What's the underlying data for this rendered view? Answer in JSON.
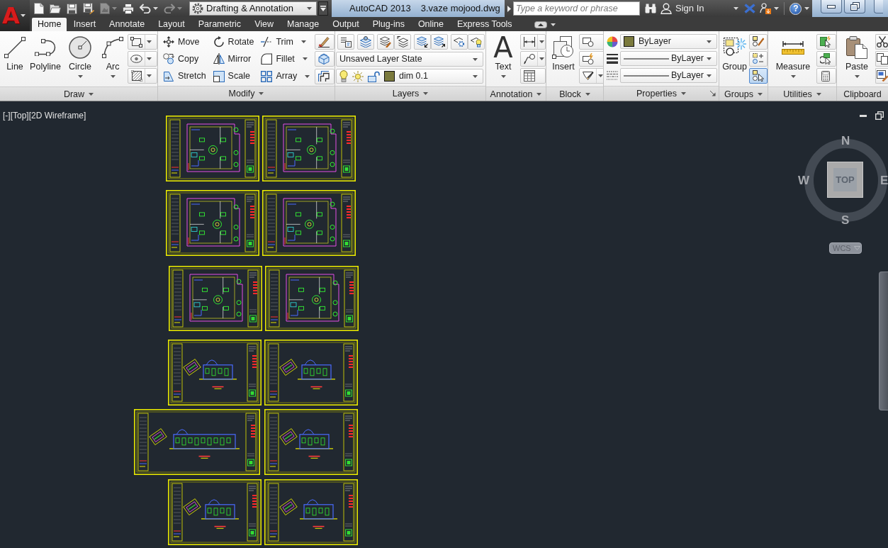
{
  "app_button": {
    "logo": "A"
  },
  "quick_access": {
    "tools": [
      {
        "disabled": false,
        "dropdown": false
      },
      {
        "disabled": false,
        "dropdown": false
      },
      {
        "disabled": false,
        "dropdown": false
      },
      {
        "disabled": false,
        "dropdown": false
      },
      {
        "disabled": true,
        "dropdown": true
      },
      {
        "disabled": false,
        "dropdown": false
      },
      {
        "disabled": false,
        "dropdown": true
      },
      {
        "disabled": true,
        "dropdown": true
      }
    ],
    "workspace": "Drafting & Annotation"
  },
  "title_bar": {
    "app_title": "AutoCAD 2013",
    "file_name": "3.vaze mojood.dwg",
    "search": {
      "placeholder": "Type a keyword or phrase"
    },
    "sign_in": "Sign In",
    "help": "?"
  },
  "ribbon_tabs": [
    {
      "label": "Home",
      "selected": true
    },
    {
      "label": "Insert",
      "selected": false
    },
    {
      "label": "Annotate",
      "selected": false
    },
    {
      "label": "Layout",
      "selected": false
    },
    {
      "label": "Parametric",
      "selected": false
    },
    {
      "label": "View",
      "selected": false
    },
    {
      "label": "Manage",
      "selected": false
    },
    {
      "label": "Output",
      "selected": false
    },
    {
      "label": "Plug-ins",
      "selected": false
    },
    {
      "label": "Online",
      "selected": false
    },
    {
      "label": "Express Tools",
      "selected": false
    }
  ],
  "draw_panel": {
    "title": "Draw",
    "expandable": true,
    "large_tools": [
      {
        "label": "Line",
        "dropdown": false
      },
      {
        "label": "Polyline",
        "dropdown": false
      },
      {
        "label": "Circle",
        "dropdown": true
      },
      {
        "label": "Arc",
        "dropdown": true
      }
    ],
    "small_tools": [
      {
        "dropdown": true
      },
      {
        "dropdown": true
      },
      {
        "dropdown": true
      }
    ]
  },
  "modify_panel": {
    "title": "Modify",
    "expandable": true,
    "tools": [
      {
        "label": "Move",
        "dropdown": false
      },
      {
        "label": "Rotate",
        "dropdown": false
      },
      {
        "label": "Trim",
        "dropdown": true
      },
      {
        "label": "Copy",
        "dropdown": false
      },
      {
        "label": "Mirror",
        "dropdown": false
      },
      {
        "label": "Fillet",
        "dropdown": true
      },
      {
        "label": "Stretch",
        "dropdown": false
      },
      {
        "label": "Scale",
        "dropdown": false
      },
      {
        "label": "Array",
        "dropdown": true
      }
    ]
  },
  "layers_panel": {
    "title": "Layers",
    "expandable": true,
    "layer_state": "Unsaved Layer State",
    "layer": {
      "name": "dim 0.1",
      "color": "#7b7a3d"
    }
  },
  "annotation_panel": {
    "title": "Annotation",
    "expandable": true,
    "large_tool": {
      "label": "Text",
      "icon": "A",
      "dropdown": true
    },
    "small_tools": [
      {
        "dropdown": true
      },
      {
        "dropdown": true
      },
      {
        "dropdown": false
      }
    ]
  },
  "block_panel": {
    "title": "Block",
    "expandable": true,
    "large_tool": {
      "label": "Insert",
      "dropdown": false
    },
    "small_tools": [
      {
        "dropdown": false
      },
      {
        "dropdown": false
      },
      {
        "dropdown": true
      }
    ]
  },
  "properties_panel": {
    "title": "Properties",
    "expandable": true,
    "launcher": true,
    "color": {
      "label": "ByLayer",
      "color": "#7b7a3d"
    },
    "lineweight": "ByLayer",
    "linetype": "ByLayer"
  },
  "groups_panel": {
    "title": "Groups",
    "expandable": true,
    "large_tool": {
      "label": "Group",
      "dropdown": false
    },
    "small_tools": [
      {
        "on": false
      },
      {
        "on": false
      },
      {
        "on": true
      }
    ]
  },
  "utilities_panel": {
    "title": "Utilities",
    "expandable": true,
    "large_tool": {
      "label": "Measure",
      "dropdown": true
    }
  },
  "clipboard_panel": {
    "title": "Clipboard",
    "expandable": false,
    "large_tool": {
      "label": "Paste",
      "dropdown": true
    }
  },
  "viewport": {
    "controls": [
      "[-]",
      "[Top]",
      "[2D Wireframe]"
    ],
    "viewcube": {
      "face": "TOP",
      "north": "N",
      "south": "S",
      "west": "W",
      "east": "E",
      "ucs": "WCS"
    },
    "sheets": [
      {
        "kind": "floor_plan"
      },
      {
        "kind": "floor_plan"
      },
      {
        "kind": "floor_plan"
      },
      {
        "kind": "floor_plan"
      },
      {
        "kind": "floor_plan"
      },
      {
        "kind": "floor_plan"
      },
      {
        "kind": "elevation"
      },
      {
        "kind": "elevation"
      },
      {
        "kind": "elevation"
      },
      {
        "kind": "elevation"
      },
      {
        "kind": "elevation"
      },
      {
        "kind": "elevation"
      }
    ]
  }
}
